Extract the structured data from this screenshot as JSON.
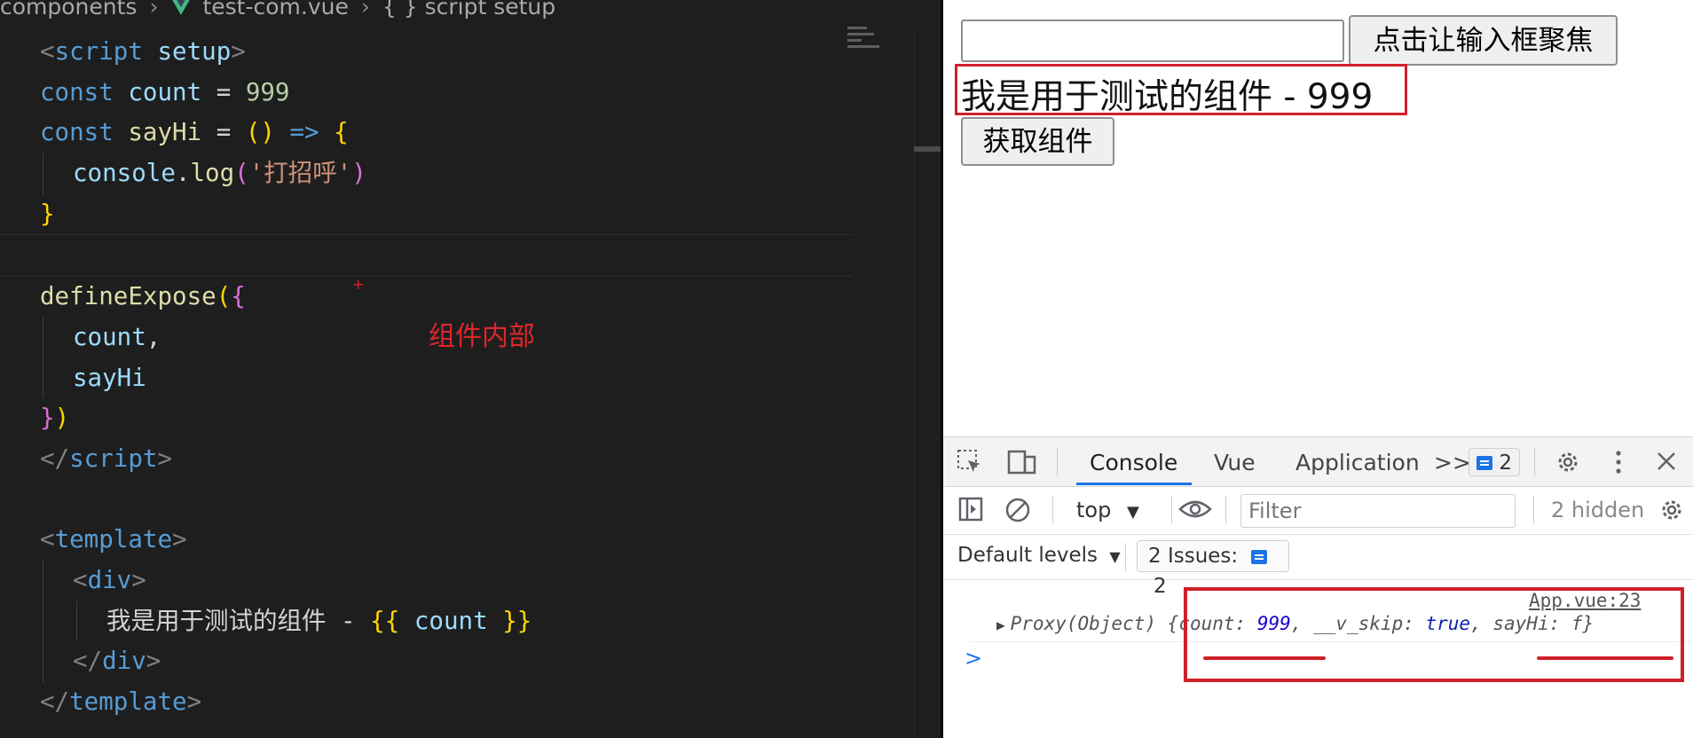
{
  "editor": {
    "breadcrumb": {
      "folder": "components",
      "file": "test-com.vue",
      "symbol": "{ } script setup"
    },
    "annotation_label": "组件内部",
    "annotation_cursor": "+",
    "code": {
      "l1_open": "<",
      "l1_tag": "script",
      "l1_attr": " setup",
      "l1_close": ">",
      "l2_kw": "const",
      "l2_var": " count",
      "l2_eq": " = ",
      "l2_num": "999",
      "l3_kw": "const",
      "l3_fn": " sayHi",
      "l3_eq": " = ",
      "l3_paren": "()",
      "l3_arrow": " =>",
      "l3_brace": " {",
      "l4_obj": "console",
      "l4_dot": ".",
      "l4_fn": "log",
      "l4_paren_open": "(",
      "l4_str": "'打招呼'",
      "l4_paren_close": ")",
      "l5_brace": "}",
      "l7_fn": "defineExpose",
      "l7_paren": "(",
      "l7_brace": "{",
      "l8_var": "count",
      "l8_comma": ",",
      "l9_var": "sayHi",
      "l10_brace": "}",
      "l10_paren": ")",
      "l11_open": "</",
      "l11_tag": "script",
      "l11_close": ">",
      "l13_open": "<",
      "l13_tag": "template",
      "l13_close": ">",
      "l14_open": "<",
      "l14_tag": "div",
      "l14_close": ">",
      "l15_text": "我是用于测试的组件 - ",
      "l15_mustache_open": "{{",
      "l15_var": " count ",
      "l15_mustache_close": "}}",
      "l16_open": "</",
      "l16_tag": "div",
      "l16_close": ">",
      "l17_open": "</",
      "l17_tag": "template",
      "l17_close": ">"
    }
  },
  "browser": {
    "input_value": "",
    "focus_button_label": "点击让输入框聚焦",
    "component_text": "我是用于测试的组件 - 999",
    "get_component_label": "获取组件",
    "devtools": {
      "tabs": [
        "Console",
        "Vue",
        "Application"
      ],
      "more_tabs": ">>",
      "issues_badge_count": "2",
      "context": "top",
      "filter_placeholder": "Filter",
      "hidden_count": "2 hidden",
      "levels": "Default levels",
      "issues_label": "2 Issues:",
      "issues_count": "2",
      "log_source": "App.vue:23",
      "log": {
        "prefix": "Proxy(Object) ",
        "open": "{",
        "k1": "count: ",
        "v1": "999",
        "sep1": ", ",
        "k2": "__v_skip: ",
        "v2": "true",
        "sep2": ", ",
        "k3": "sayHi: ",
        "v3": "f",
        "close": "}"
      },
      "prompt": ">"
    }
  },
  "colors": {
    "annotation_red": "#d0202a",
    "tab_accent": "#1a73e8"
  }
}
